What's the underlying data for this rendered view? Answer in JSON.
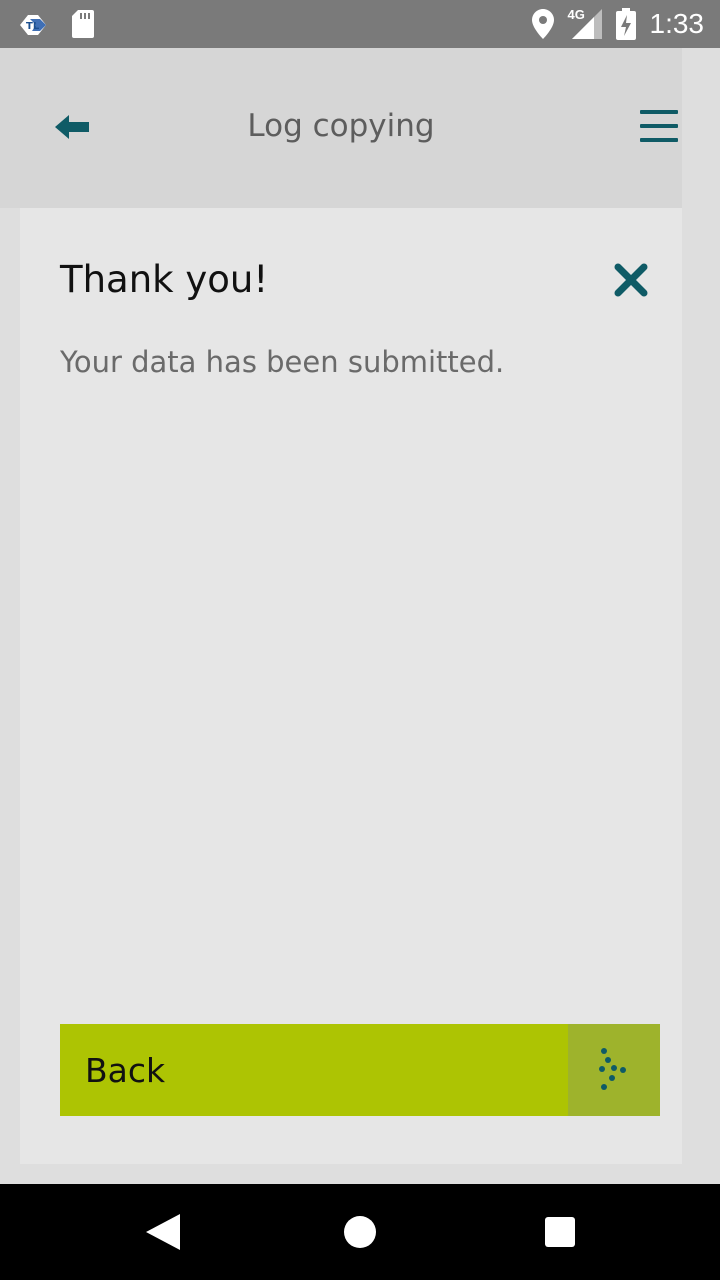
{
  "status_bar": {
    "time": "1:33",
    "network": "4G",
    "icons": [
      "app-notification-icon",
      "sd-card-icon",
      "location-icon",
      "signal-icon",
      "battery-charging-icon"
    ]
  },
  "header": {
    "title": "Log copying",
    "back_icon": "back-arrow-icon",
    "menu_icon": "hamburger-menu-icon"
  },
  "dialog": {
    "title": "Thank you!",
    "message": "Your data has been submitted.",
    "close_icon": "close-icon"
  },
  "actions": {
    "back_label": "Back"
  },
  "colors": {
    "accent": "#adc403",
    "accent_dark": "#9eb32c",
    "icon_teal": "#0f5b66",
    "status_bar": "#7a7a7a"
  },
  "nav_bar": {
    "icons": [
      "nav-back-icon",
      "nav-home-icon",
      "nav-recents-icon"
    ]
  }
}
